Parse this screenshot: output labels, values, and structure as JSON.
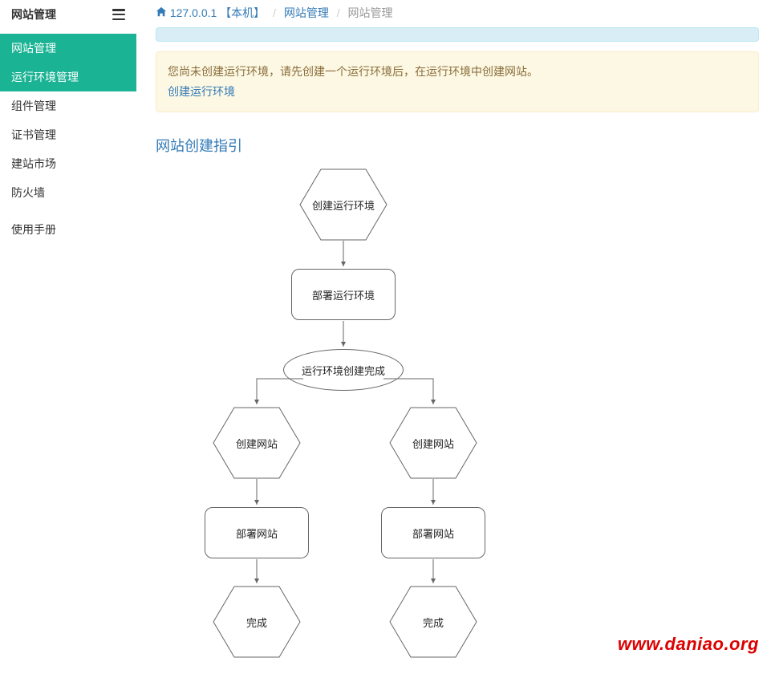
{
  "sidebar": {
    "title": "网站管理",
    "items": [
      {
        "label": "网站管理",
        "active": true
      },
      {
        "label": "运行环境管理",
        "active": true
      },
      {
        "label": "组件管理",
        "active": false
      },
      {
        "label": "证书管理",
        "active": false
      },
      {
        "label": "建站市场",
        "active": false
      },
      {
        "label": "防火墙",
        "active": false
      },
      {
        "label": "使用手册",
        "active": false
      }
    ]
  },
  "breadcrumb": {
    "host": "127.0.0.1 【本机】",
    "mid": "网站管理",
    "current": "网站管理",
    "sep": "/"
  },
  "alert": {
    "text": "您尚未创建运行环境，请先创建一个运行环境后，在运行环境中创建网站。",
    "link": "创建运行环境"
  },
  "section_title": "网站创建指引",
  "diagram": {
    "n1": "创建运行环境",
    "n2": "部署运行环境",
    "n3": "运行环境创建完成",
    "n4": "创建网站",
    "n5": "创建网站",
    "n6": "部署网站",
    "n7": "部署网站",
    "n8": "完成",
    "n9": "完成"
  },
  "watermark": "www.daniao.org"
}
